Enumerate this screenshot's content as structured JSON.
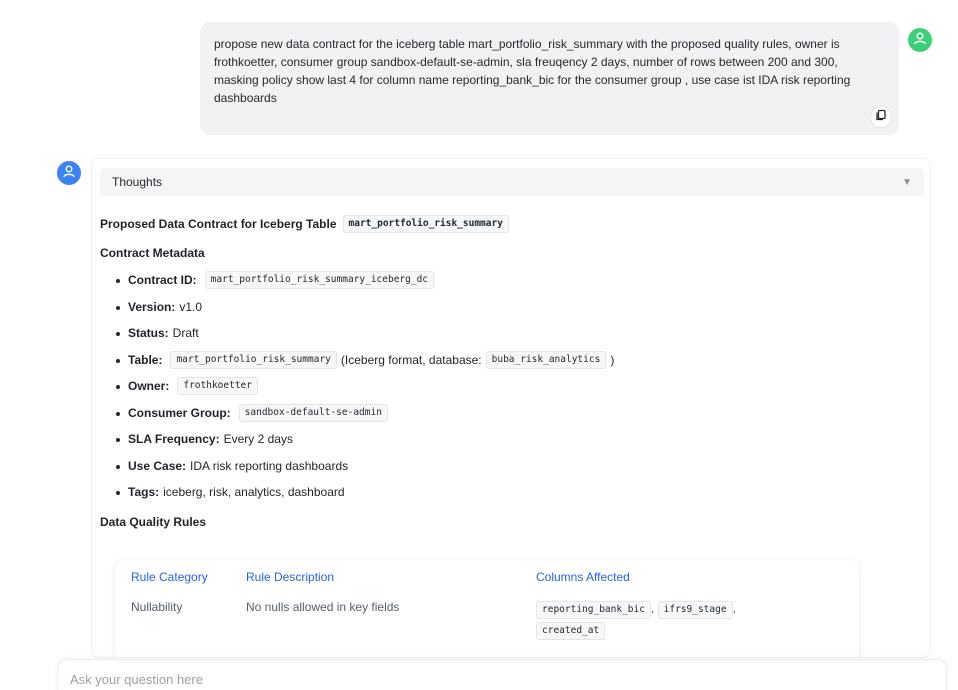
{
  "user_message": {
    "text": "propose new data contract for the iceberg table mart_portfolio_risk_summary with the proposed quality rules, owner is frothkoetter, consumer group sandbox-default-se-admin, sla freuqency 2 days, number of rows between 200 and 300, masking policy show last 4 for column name reporting_bank_bic for the consumer group , use case ist IDA risk reporting dashboards"
  },
  "icons": {
    "user_avatar": "user-icon",
    "assistant_avatar": "user-icon",
    "copy": "copy-icon",
    "expand": "triangle-down-icon"
  },
  "colors": {
    "user_avatar": "#3fcf78",
    "assistant_avatar": "#3b82f6",
    "table_header": "#2563eb"
  },
  "thoughts": {
    "label": "Thoughts",
    "arrow": "▼"
  },
  "proposal": {
    "title": "Proposed Data Contract for Iceberg Table",
    "table_code": "mart_portfolio_risk_summary"
  },
  "metadata": {
    "heading": "Contract Metadata",
    "contract_id_label": "Contract ID:",
    "contract_id_value": "mart_portfolio_risk_summary_iceberg_dc",
    "version_label": "Version:",
    "version_value": "v1.0",
    "status_label": "Status:",
    "status_value": "Draft",
    "table_label": "Table:",
    "table_value": "mart_portfolio_risk_summary",
    "table_format_text": "(Iceberg format, database:",
    "database_value": "buba_risk_analytics",
    "table_close": ")",
    "owner_label": "Owner:",
    "owner_value": "frothkoetter",
    "consumer_label": "Consumer Group:",
    "consumer_value": "sandbox-default-se-admin",
    "sla_label": "SLA Frequency:",
    "sla_value": "Every 2 days",
    "usecase_label": "Use Case:",
    "usecase_value": "IDA risk reporting dashboards",
    "tags_label": "Tags:",
    "tags_value": "iceberg, risk, analytics, dashboard"
  },
  "quality": {
    "heading": "Data Quality Rules",
    "headers": [
      "Rule Category",
      "Rule Description",
      "Columns Affected"
    ],
    "rows": [
      {
        "category": "Nullability",
        "description": "No nulls allowed in key fields",
        "columns": [
          "reporting_bank_bic",
          "ifrs9_stage",
          "created_at"
        ],
        "separator": ","
      }
    ]
  },
  "input": {
    "placeholder": "Ask your question here"
  }
}
